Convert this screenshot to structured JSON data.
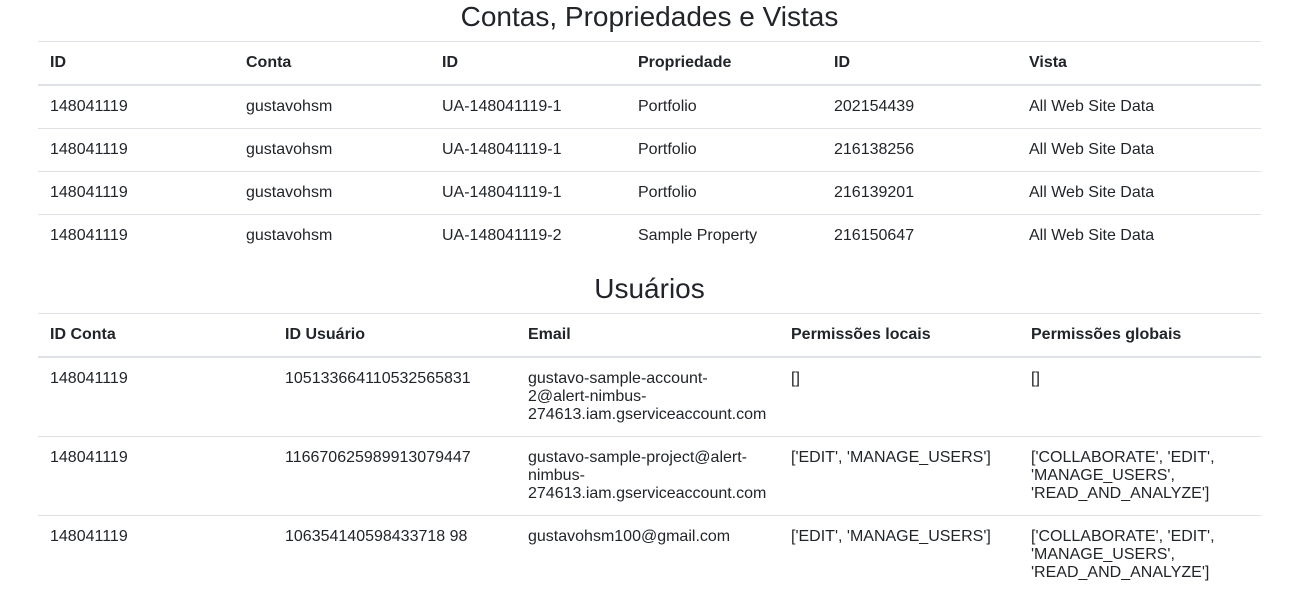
{
  "accounts_section": {
    "title": "Contas, Propriedades e Vistas",
    "headers": [
      "ID",
      "Conta",
      "ID",
      "Propriedade",
      "ID",
      "Vista"
    ],
    "rows": [
      [
        "148041119",
        "gustavohsm",
        "UA-148041119-1",
        "Portfolio",
        "202154439",
        "All Web Site Data"
      ],
      [
        "148041119",
        "gustavohsm",
        "UA-148041119-1",
        "Portfolio",
        "216138256",
        "All Web Site Data"
      ],
      [
        "148041119",
        "gustavohsm",
        "UA-148041119-1",
        "Portfolio",
        "216139201",
        "All Web Site Data"
      ],
      [
        "148041119",
        "gustavohsm",
        "UA-148041119-2",
        "Sample Property",
        "216150647",
        "All Web Site Data"
      ]
    ]
  },
  "users_section": {
    "title": "Usuários",
    "headers": [
      "ID Conta",
      "ID Usuário",
      "Email",
      "Permissões locais",
      "Permissões globais"
    ],
    "rows": [
      [
        "148041119",
        "105133664110532565831",
        "gustavo-sample-account-2@alert-nimbus-274613.iam.gserviceaccount.com",
        "[]",
        "[]"
      ],
      [
        "148041119",
        "116670625989913079447",
        "gustavo-sample-project@alert-nimbus-274613.iam.gserviceaccount.com",
        "['EDIT', 'MANAGE_USERS']",
        "['COLLABORATE', 'EDIT', 'MANAGE_USERS', 'READ_AND_ANALYZE']"
      ],
      [
        "148041119",
        "106354140598433718 98",
        "gustavohsm100@gmail.com",
        "['EDIT', 'MANAGE_USERS']",
        "['COLLABORATE', 'EDIT', 'MANAGE_USERS', 'READ_AND_ANALYZE']"
      ]
    ]
  }
}
